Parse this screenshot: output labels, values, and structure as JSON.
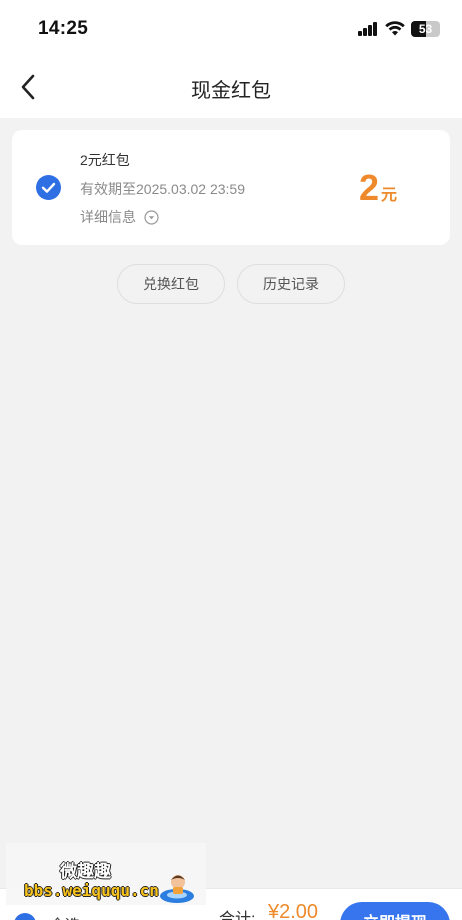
{
  "status_bar": {
    "time": "14:25",
    "battery": "53"
  },
  "nav": {
    "title": "现金红包"
  },
  "red_packet": {
    "title": "2元红包",
    "expiry": "有效期至2025.03.02 23:59",
    "detail_label": "详细信息",
    "amount": "2",
    "unit": "元",
    "selected": true
  },
  "actions": {
    "exchange_label": "兑换红包",
    "history_label": "历史记录"
  },
  "footer": {
    "select_all_label": "全选",
    "total_label": "合计:",
    "total_amount": "¥2.00",
    "withdraw_label": "立即提现"
  },
  "watermark": {
    "title": "微趣趣",
    "url": "bbs.weiququ.cn"
  },
  "colors": {
    "accent_blue": "#2f6fe4",
    "amount_orange": "#ee8a2b",
    "background": "#f2f2f2"
  },
  "icons": [
    "back-arrow-icon",
    "check-icon",
    "chevron-down-circle-icon",
    "signal-icon",
    "wifi-icon",
    "battery-icon"
  ]
}
